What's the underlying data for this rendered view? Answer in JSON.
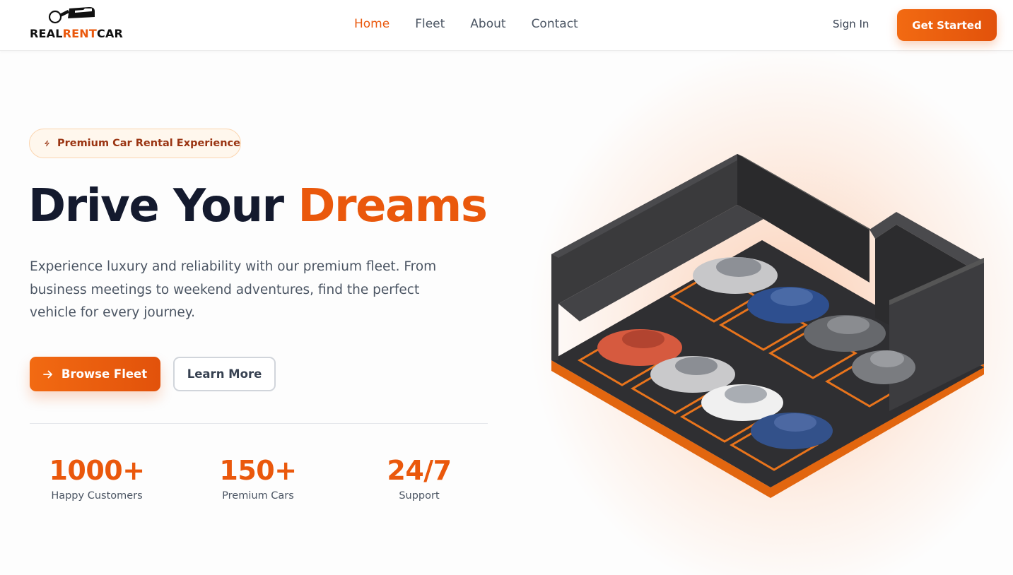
{
  "brand": {
    "name_part1": "REAL",
    "name_part2": "RENT",
    "name_part3": "CAR",
    "accent_color": "#ea580c"
  },
  "nav": {
    "items": [
      {
        "label": "Home",
        "active": true
      },
      {
        "label": "Fleet",
        "active": false
      },
      {
        "label": "About",
        "active": false
      },
      {
        "label": "Contact",
        "active": false
      }
    ]
  },
  "header": {
    "signin_label": "Sign In",
    "cta_label": "Get Started"
  },
  "hero": {
    "badge_icon": "lightning-icon",
    "badge_text": "Premium Car Rental Experience",
    "headline_part1": "Drive Your ",
    "headline_part2": "Dreams",
    "description": "Experience luxury and reliability with our premium fleet. From business meetings to weekend adventures, find the perfect vehicle for every journey.",
    "primary_button": "Browse Fleet",
    "secondary_button": "Learn More",
    "image_icon": "isometric-parking-garage-illustration"
  },
  "stats": [
    {
      "value": "1000+",
      "label": "Happy Customers"
    },
    {
      "value": "150+",
      "label": "Premium Cars"
    },
    {
      "value": "24/7",
      "label": "Support"
    }
  ]
}
